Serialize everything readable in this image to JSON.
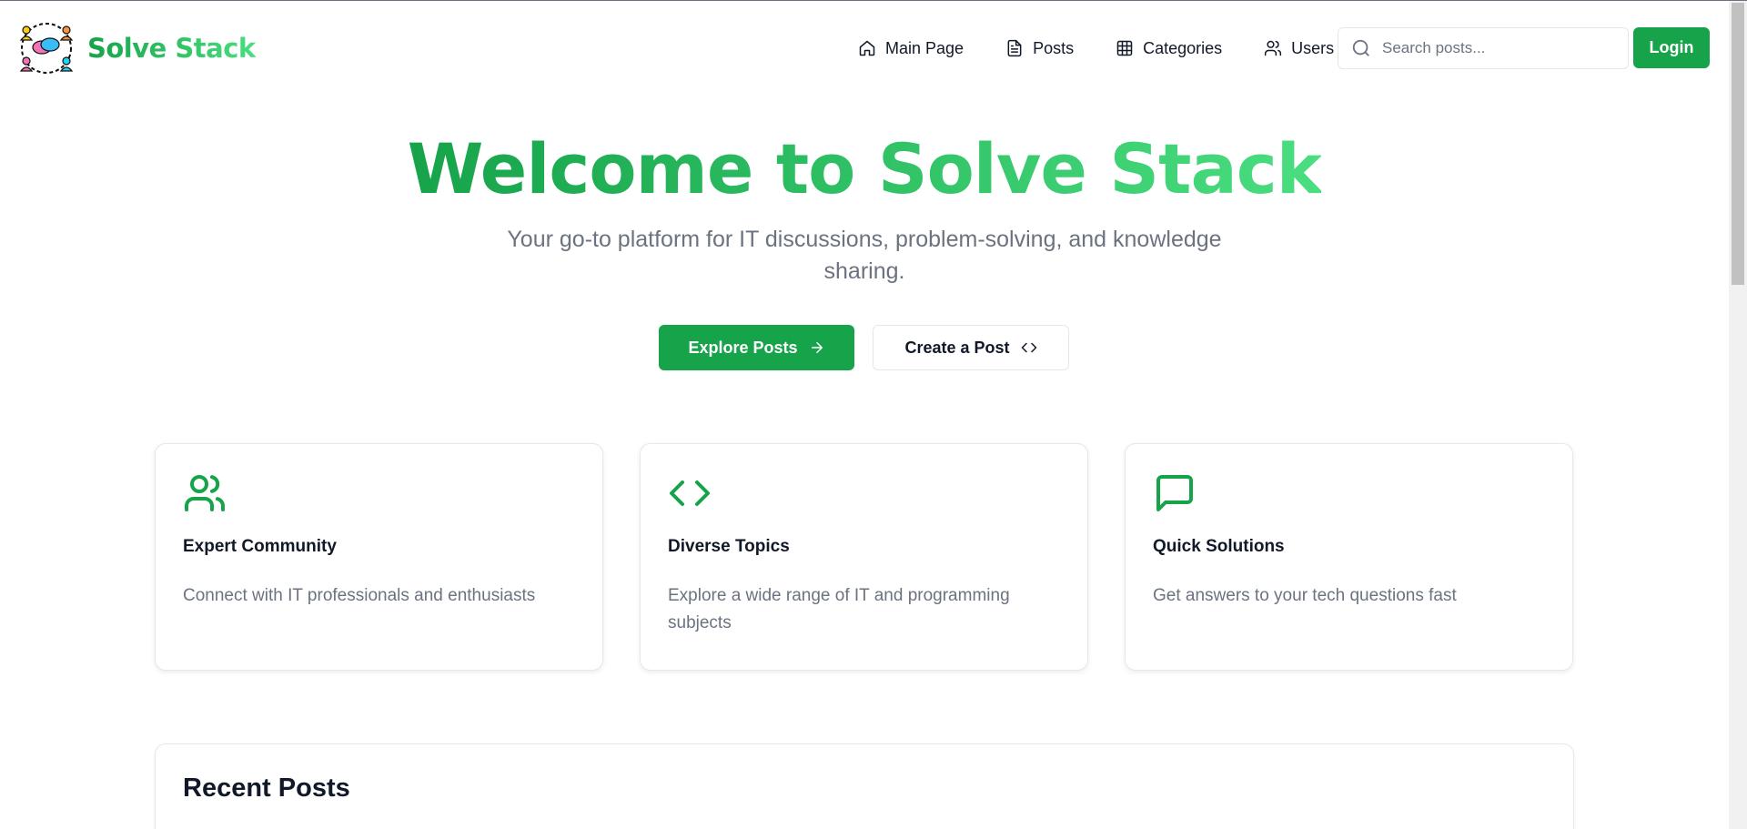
{
  "brand": {
    "name": "Solve Stack",
    "accent": "#16a34a"
  },
  "nav": {
    "items": [
      {
        "label": "Main Page",
        "icon": "home-icon"
      },
      {
        "label": "Posts",
        "icon": "file-text-icon"
      },
      {
        "label": "Categories",
        "icon": "grid-icon"
      },
      {
        "label": "Users",
        "icon": "users-icon"
      }
    ],
    "search_placeholder": "Search posts...",
    "login_label": "Login"
  },
  "hero": {
    "title": "Welcome to Solve Stack",
    "subtitle": "Your go-to platform for IT discussions, problem-solving, and knowledge sharing.",
    "primary_cta": "Explore Posts",
    "secondary_cta": "Create a Post"
  },
  "features": [
    {
      "icon": "users-icon",
      "title": "Expert Community",
      "description": "Connect with IT professionals and enthusiasts"
    },
    {
      "icon": "code-icon",
      "title": "Diverse Topics",
      "description": "Explore a wide range of IT and programming subjects"
    },
    {
      "icon": "message-square-icon",
      "title": "Quick Solutions",
      "description": "Get answers to your tech questions fast"
    }
  ],
  "recent_posts": {
    "title": "Recent Posts"
  }
}
